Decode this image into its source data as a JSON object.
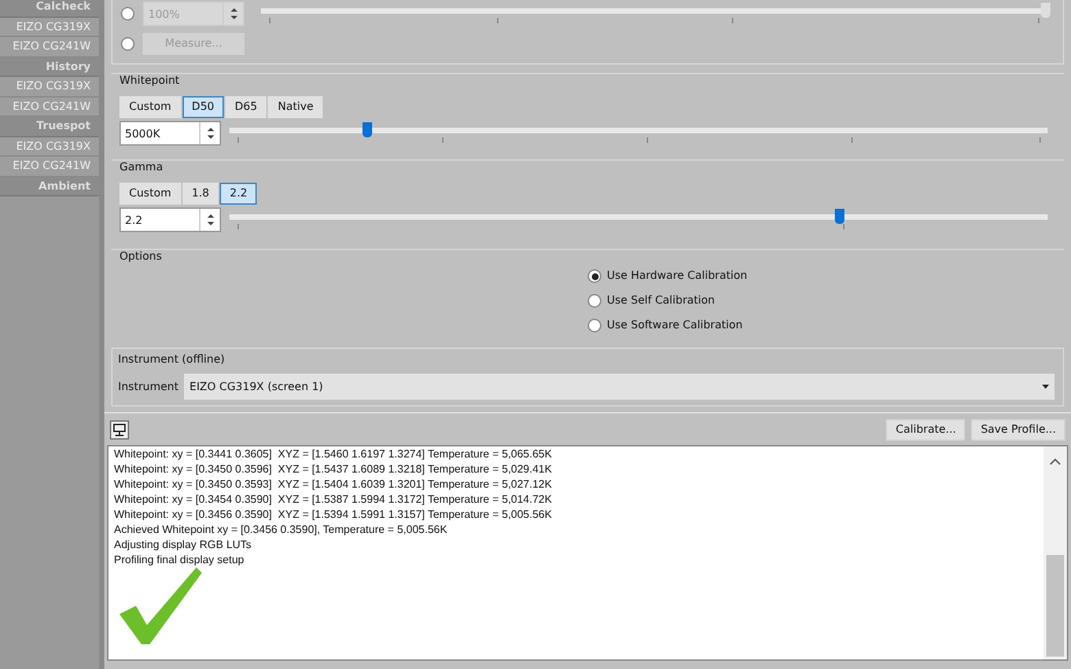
{
  "sidebar": {
    "groups": [
      {
        "label": "Calcheck",
        "items": [
          "EIZO CG319X",
          "EIZO CG241W"
        ]
      },
      {
        "label": "History",
        "items": [
          "EIZO CG319X",
          "EIZO CG241W"
        ]
      },
      {
        "label": "Truespot",
        "items": [
          "EIZO CG319X",
          "EIZO CG241W"
        ]
      },
      {
        "label": "Ambient"
      }
    ]
  },
  "luminance": {
    "radios": [
      {
        "kind": "spin",
        "selected": false,
        "value": "100%",
        "disabled": true,
        "level": 1.0
      },
      {
        "kind": "button",
        "selected": false,
        "label": "Measure...",
        "disabled": true
      }
    ]
  },
  "whitepoint": {
    "title": "Whitepoint",
    "presets": [
      {
        "label": "Custom",
        "selected": false
      },
      {
        "label": "D50",
        "selected": true
      },
      {
        "label": "D65",
        "selected": false
      },
      {
        "label": "Native",
        "selected": false
      }
    ],
    "value": "5000K",
    "level": 0.17
  },
  "gamma": {
    "title": "Gamma",
    "presets": [
      {
        "label": "Custom",
        "selected": false
      },
      {
        "label": "1.8",
        "selected": false
      },
      {
        "label": "2.2",
        "selected": true
      }
    ],
    "value": "2.2",
    "level": 0.746
  },
  "options": {
    "title": "Options",
    "radios": [
      {
        "label": "Use Hardware Calibration",
        "selected": true
      },
      {
        "label": "Use Self Calibration",
        "selected": false
      },
      {
        "label": "Use Software Calibration",
        "selected": false
      }
    ]
  },
  "instrument": {
    "title": "Instrument (offline)",
    "label": "Instrument",
    "value": "EIZO CG319X (screen 1)"
  },
  "toolbar": {
    "buttons": [
      "Calibrate...",
      "Save Profile..."
    ]
  },
  "log": {
    "lines": [
      "Whitepoint: xy = [0.3441 0.3605]  XYZ = [1.5460 1.6197 1.3274] Temperature = 5,065.65K",
      "Whitepoint: xy = [0.3450 0.3596]  XYZ = [1.5437 1.6089 1.3218] Temperature = 5,029.41K",
      "Whitepoint: xy = [0.3450 0.3593]  XYZ = [1.5404 1.6039 1.3201] Temperature = 5,027.12K",
      "Whitepoint: xy = [0.3454 0.3590]  XYZ = [1.5387 1.5994 1.3172] Temperature = 5,014.72K",
      "Whitepoint: xy = [0.3456 0.3590]  XYZ = [1.5394 1.5991 1.3157] Temperature = 5,005.56K",
      "Achieved Whitepoint xy = [0.3456 0.3590], Temperature = 5,005.56K",
      "Adjusting display RGB LUTs",
      "Profiling final display setup"
    ]
  }
}
